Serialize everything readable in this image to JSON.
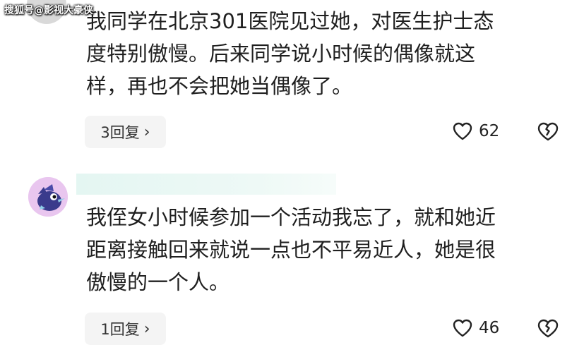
{
  "watermark": "搜狐号@影视大豪侠",
  "comment1": {
    "lines": [
      "我同学在北京301医院见过她，对医生护士态",
      "度特别傲慢。后来同学说小时候的偶像就这",
      "样，再也不会把她当偶像了。"
    ],
    "reply_label": "3回复",
    "likes": "62"
  },
  "comment2": {
    "lines": [
      "我侄女小时候参加一个活动我忘了，就和她近",
      "距离接触回来就说一点也不平易近人，她是很",
      "傲慢的一个人。"
    ],
    "reply_label": "1回复",
    "likes": "46"
  },
  "icons": {
    "like": "heart-outline-icon",
    "dislike": "broken-heart-icon",
    "chevron": "chevron-right-icon"
  },
  "colors": {
    "avatar_bg": "#e9c6ef",
    "avatar_bird": "#3a3b8c",
    "username_bar": "#e4f6f2"
  }
}
